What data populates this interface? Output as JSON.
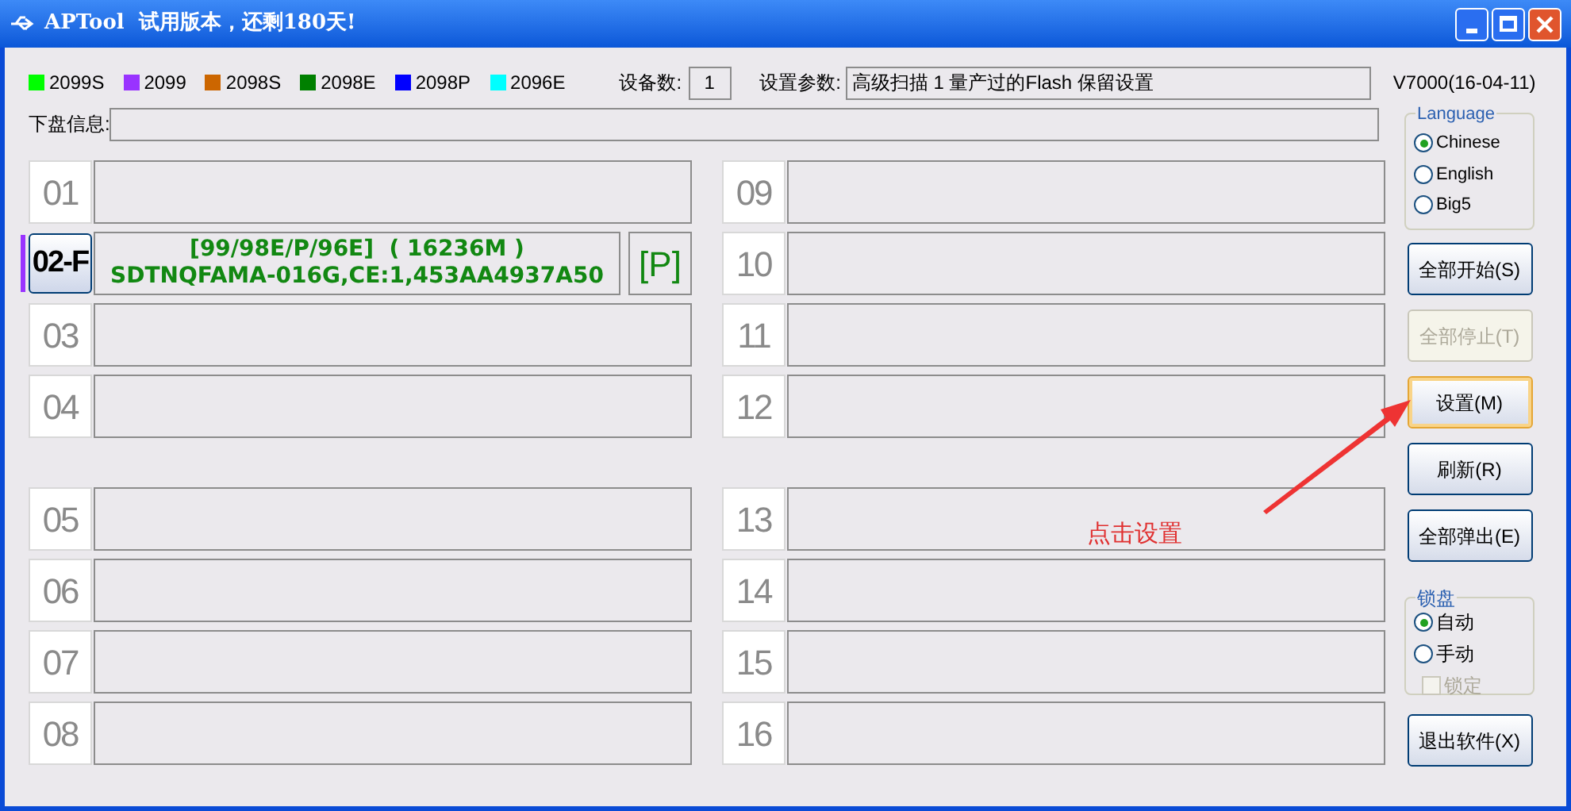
{
  "window": {
    "title": "APTool  试用版本，还剩180天!"
  },
  "legend": [
    {
      "label": "2099S",
      "color": "#00ff00"
    },
    {
      "label": "2099",
      "color": "#9933ff"
    },
    {
      "label": "2098S",
      "color": "#cc6600"
    },
    {
      "label": "2098E",
      "color": "#008000"
    },
    {
      "label": "2098P",
      "color": "#0000ff"
    },
    {
      "label": "2096E",
      "color": "#00ffff"
    }
  ],
  "device_count": {
    "label": "设备数:",
    "value": "1"
  },
  "settings_params": {
    "label": "设置参数:",
    "value": "高级扫描 1 量产过的Flash 保留设置"
  },
  "version": "V7000(16-04-11)",
  "disk_info": {
    "label": "下盘信息:"
  },
  "columns": [
    {
      "groups": [
        [
          {
            "kind": "empty",
            "number": "01"
          },
          {
            "kind": "active",
            "number": "02-F",
            "color": "#9933ff",
            "lines": [
              "[99/98E/P/96E]  ( 16236M )",
              "SDTNQFAMA-016G,CE:1,453AA4937A50"
            ],
            "tag": "[P]"
          },
          {
            "kind": "empty",
            "number": "03"
          },
          {
            "kind": "empty",
            "number": "04"
          }
        ],
        [
          {
            "kind": "empty",
            "number": "05"
          },
          {
            "kind": "empty",
            "number": "06"
          },
          {
            "kind": "empty",
            "number": "07"
          },
          {
            "kind": "empty",
            "number": "08"
          }
        ]
      ]
    },
    {
      "groups": [
        [
          {
            "kind": "empty",
            "number": "09"
          },
          {
            "kind": "empty",
            "number": "10"
          },
          {
            "kind": "empty",
            "number": "11"
          },
          {
            "kind": "empty",
            "number": "12"
          }
        ],
        [
          {
            "kind": "empty",
            "number": "13"
          },
          {
            "kind": "empty",
            "number": "14"
          },
          {
            "kind": "empty",
            "number": "15"
          },
          {
            "kind": "empty",
            "number": "16"
          }
        ]
      ]
    }
  ],
  "language": {
    "title": "Language",
    "options": [
      {
        "label": "Chinese",
        "selected": true
      },
      {
        "label": "English",
        "selected": false
      },
      {
        "label": "Big5",
        "selected": false
      }
    ]
  },
  "buttons_top": [
    {
      "label": "全部开始(S)",
      "disabled": false,
      "focused": false
    },
    {
      "label": "全部停止(T)",
      "disabled": true,
      "focused": false
    },
    {
      "label": "设置(M)",
      "disabled": false,
      "focused": true
    },
    {
      "label": "刷新(R)",
      "disabled": false,
      "focused": false
    },
    {
      "label": "全部弹出(E)",
      "disabled": false,
      "focused": false
    }
  ],
  "lock": {
    "title": "锁盘",
    "options": [
      {
        "label": "自动",
        "selected": true
      },
      {
        "label": "手动",
        "selected": false
      }
    ],
    "checkbox": {
      "label": "锁定",
      "checked": false,
      "disabled": true
    }
  },
  "exit_button": {
    "label": "退出软件(X)"
  },
  "annotation": {
    "text": "点击设置"
  }
}
